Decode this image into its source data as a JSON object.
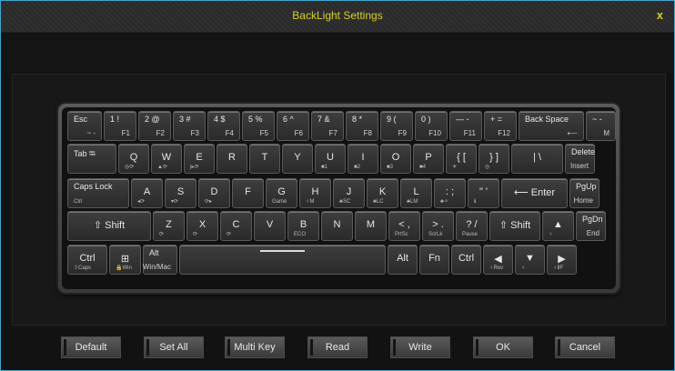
{
  "window": {
    "title": "BackLight Settings",
    "close_label": "x"
  },
  "keyboard": {
    "rows": [
      [
        {
          "name": "key-esc",
          "top": "Esc",
          "bot": "~ -"
        },
        {
          "name": "key-f1",
          "top": "1 !",
          "bot": "F1"
        },
        {
          "name": "key-f2",
          "top": "2 @",
          "bot": "F2"
        },
        {
          "name": "key-f3",
          "top": "3 #",
          "bot": "F3"
        },
        {
          "name": "key-f4",
          "top": "4 $",
          "bot": "F4"
        },
        {
          "name": "key-f5",
          "top": "5 %",
          "bot": "F5"
        },
        {
          "name": "key-f6",
          "top": "6 ^",
          "bot": "F6"
        },
        {
          "name": "key-f7",
          "top": "7 &",
          "bot": "F7"
        },
        {
          "name": "key-f8",
          "top": "8 *",
          "bot": "F8"
        },
        {
          "name": "key-f9",
          "top": "9 (",
          "bot": "F9"
        },
        {
          "name": "key-f10",
          "top": "0 )",
          "bot": "F10"
        },
        {
          "name": "key-f11",
          "top": "— -",
          "bot": "F11"
        },
        {
          "name": "key-f12",
          "top": "+ =",
          "bot": "F12"
        },
        {
          "name": "key-backspace",
          "top": "Back Space",
          "bot": "⟵"
        },
        {
          "name": "key-m",
          "top": "~ -",
          "bot": "M"
        }
      ],
      [
        {
          "name": "key-tab",
          "top": "Tab ⭾"
        },
        {
          "name": "key-q",
          "mid": "Q",
          "sub": "◎⟳"
        },
        {
          "name": "key-w",
          "mid": "W",
          "sub": "▲⟳"
        },
        {
          "name": "key-e",
          "mid": "E",
          "sub": "|▸⟳"
        },
        {
          "name": "key-r",
          "mid": "R"
        },
        {
          "name": "key-t",
          "mid": "T"
        },
        {
          "name": "key-y",
          "mid": "Y"
        },
        {
          "name": "key-u",
          "mid": "U",
          "sub": "■1"
        },
        {
          "name": "key-i",
          "mid": "I",
          "sub": "■2"
        },
        {
          "name": "key-o",
          "mid": "O",
          "sub": "■3"
        },
        {
          "name": "key-p",
          "mid": "P",
          "sub": "■4"
        },
        {
          "name": "key-lbracket",
          "mid": "{ [",
          "sub": "☀"
        },
        {
          "name": "key-rbracket",
          "mid": "} ]",
          "sub": "◎"
        },
        {
          "name": "key-backslash",
          "mid": "| \\"
        },
        {
          "name": "key-delete",
          "top": "Delete",
          "bot": "Insert"
        }
      ],
      [
        {
          "name": "key-capslock",
          "top": "Caps Lock",
          "sub": "Ctrl"
        },
        {
          "name": "key-a",
          "mid": "A",
          "sub": "◂⟳"
        },
        {
          "name": "key-s",
          "mid": "S",
          "sub": "▾⟳"
        },
        {
          "name": "key-d",
          "mid": "D",
          "sub": "⟳▸"
        },
        {
          "name": "key-f",
          "mid": "F"
        },
        {
          "name": "key-g",
          "mid": "G",
          "sub": "Game"
        },
        {
          "name": "key-h",
          "mid": "H",
          "sub": "♀M"
        },
        {
          "name": "key-j",
          "mid": "J",
          "sub": "♣SC"
        },
        {
          "name": "key-k",
          "mid": "K",
          "sub": "♣LC"
        },
        {
          "name": "key-l",
          "mid": "L",
          "sub": "♣LM"
        },
        {
          "name": "key-semicolon",
          "mid": ": ;",
          "sub": "♣✧"
        },
        {
          "name": "key-quote",
          "mid": "\" '",
          "sub": "ℹ"
        },
        {
          "name": "key-enter",
          "mid": "⟵ Enter"
        },
        {
          "name": "key-pgup",
          "top": "PgUp",
          "bot": "Home"
        }
      ],
      [
        {
          "name": "key-lshift",
          "mid": "⇧ Shift"
        },
        {
          "name": "key-z",
          "mid": "Z",
          "sub": "⟳"
        },
        {
          "name": "key-x",
          "mid": "X",
          "sub": "⟳"
        },
        {
          "name": "key-c",
          "mid": "C",
          "sub": "⟳"
        },
        {
          "name": "key-v",
          "mid": "V"
        },
        {
          "name": "key-b",
          "mid": "B",
          "sub": "ECO"
        },
        {
          "name": "key-n",
          "mid": "N"
        },
        {
          "name": "key-m2",
          "mid": "M"
        },
        {
          "name": "key-comma",
          "mid": "< ,",
          "sub": "PrtSc"
        },
        {
          "name": "key-period",
          "mid": "> .",
          "sub": "ScrLk"
        },
        {
          "name": "key-slash",
          "mid": "? /",
          "sub": "Pause"
        },
        {
          "name": "key-rshift",
          "mid": "⇧ Shift"
        },
        {
          "name": "key-up",
          "mid": "▲",
          "sub": "♀"
        },
        {
          "name": "key-pgdn",
          "top": "PgDn",
          "bot": "End"
        }
      ],
      [
        {
          "name": "key-ctrl-left",
          "mid": "Ctrl",
          "sub": "⇧Caps"
        },
        {
          "name": "key-win",
          "mid": "⊞",
          "sub": "🔒Win"
        },
        {
          "name": "key-alt-left",
          "top": "Alt",
          "bot": "Win/Mac"
        },
        {
          "name": "key-space",
          "mid": ""
        },
        {
          "name": "key-alt-right",
          "mid": "Alt"
        },
        {
          "name": "key-fn",
          "mid": "Fn"
        },
        {
          "name": "key-ctrl-right",
          "mid": "Ctrl"
        },
        {
          "name": "key-left",
          "mid": "◀",
          "sub": "♀Rev"
        },
        {
          "name": "key-down",
          "mid": "▼",
          "sub": "♀"
        },
        {
          "name": "key-right",
          "mid": "▶",
          "sub": "♀ⅡF"
        }
      ]
    ]
  },
  "buttons": [
    {
      "name": "default-button",
      "label": "Default"
    },
    {
      "name": "set-all-button",
      "label": "Set All"
    },
    {
      "name": "multi-key-button",
      "label": "Multi Key"
    },
    {
      "name": "read-button",
      "label": "Read"
    },
    {
      "name": "write-button",
      "label": "Write"
    },
    {
      "name": "ok-button",
      "label": "OK"
    },
    {
      "name": "cancel-button",
      "label": "Cancel"
    }
  ],
  "colors": {
    "title": "#d8d020",
    "border_accent": "#3fa6cf"
  }
}
